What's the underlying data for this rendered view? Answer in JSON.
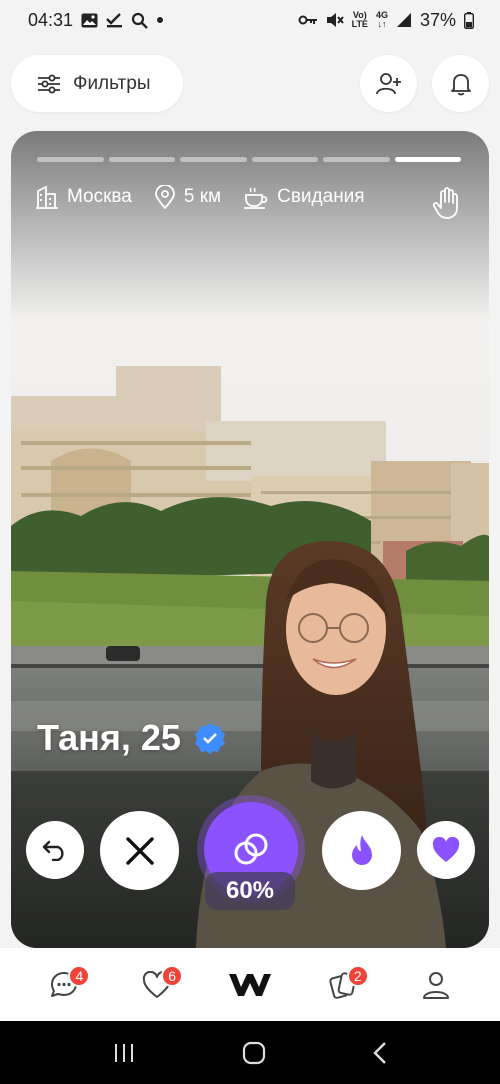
{
  "status_bar": {
    "time": "04:31",
    "network_top": "Vo)",
    "network_bottom": "LTE",
    "data_top": "4G",
    "data_bottom": "↓↑",
    "battery": "37%"
  },
  "header": {
    "filters_label": "Фильтры"
  },
  "card": {
    "progress_total": 6,
    "progress_active_index": 5,
    "city": "Москва",
    "distance": "5 км",
    "goal": "Свидания",
    "name_age": "Таня, 25",
    "match_percent": "60%"
  },
  "bottom_nav": {
    "chats_badge": "4",
    "likes_badge": "6",
    "cards_badge": "2"
  },
  "colors": {
    "accent": "#8b52ff",
    "badge": "#f0443a",
    "verified": "#3f8cff"
  }
}
